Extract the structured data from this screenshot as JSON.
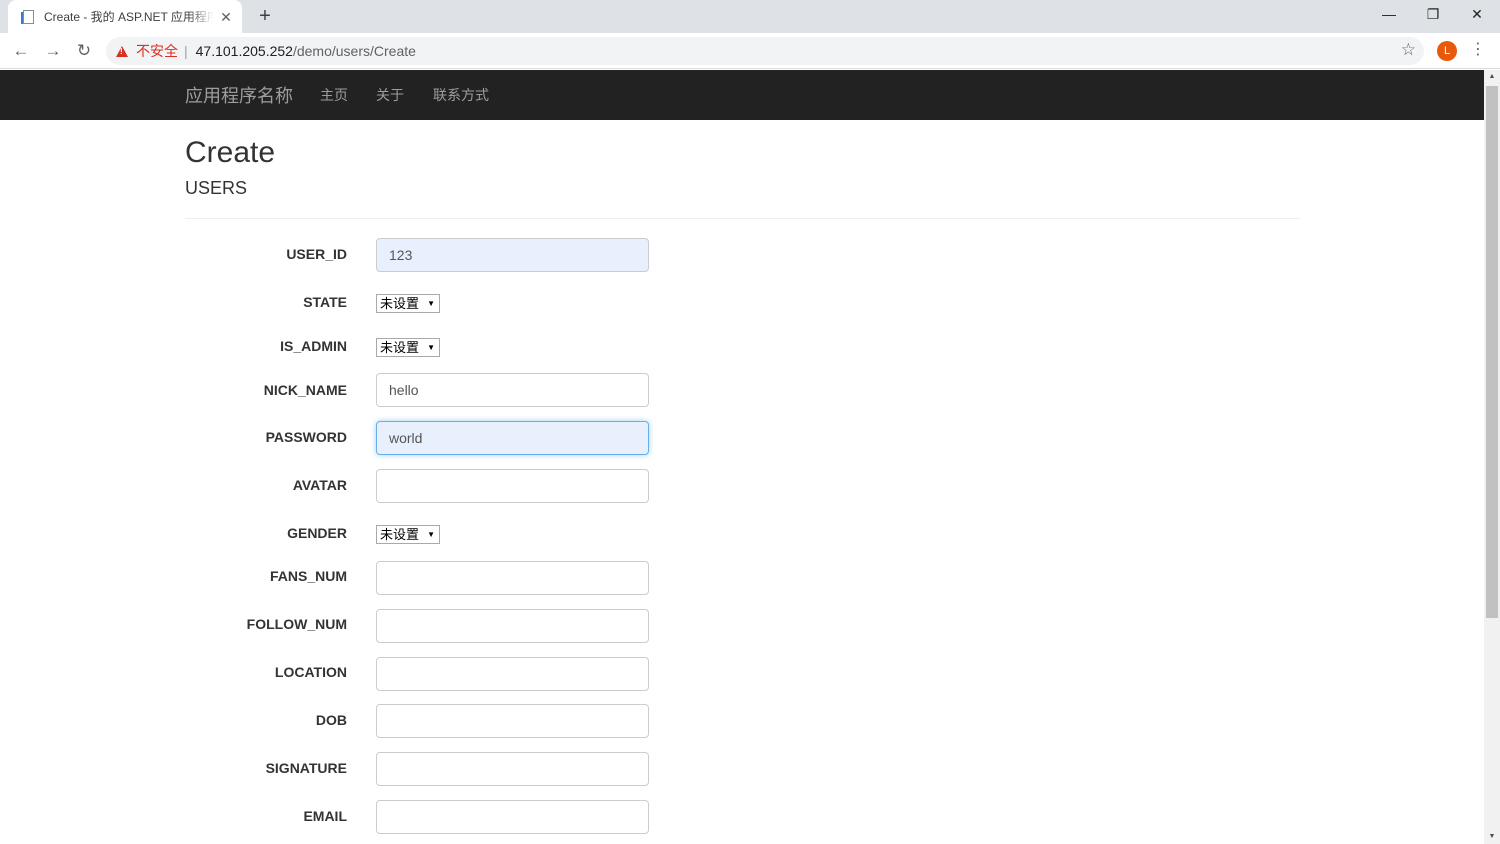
{
  "browser": {
    "tab_title": "Create - 我的 ASP.NET 应用程序",
    "tab_close": "✕",
    "new_tab": "+",
    "security_label": "不安全",
    "separator": "|",
    "url_host": "47.101.205.252",
    "url_path": "/demo/users/Create",
    "profile_initial": "L",
    "minimize": "—",
    "restore": "❐",
    "close": "✕",
    "back": "←",
    "forward": "→",
    "reload": "↻",
    "star": "☆",
    "menu": "⋮"
  },
  "navbar": {
    "brand": "应用程序名称",
    "links": [
      "主页",
      "关于",
      "联系方式"
    ]
  },
  "page": {
    "title": "Create",
    "subtitle": "USERS"
  },
  "form": {
    "user_id": {
      "label": "USER_ID",
      "value": "123"
    },
    "state": {
      "label": "STATE",
      "selected": "未设置"
    },
    "is_admin": {
      "label": "IS_ADMIN",
      "selected": "未设置"
    },
    "nick_name": {
      "label": "NICK_NAME",
      "value": "hello"
    },
    "password": {
      "label": "PASSWORD",
      "value": "world"
    },
    "avatar": {
      "label": "AVATAR",
      "value": ""
    },
    "gender": {
      "label": "GENDER",
      "selected": "未设置"
    },
    "fans_num": {
      "label": "FANS_NUM",
      "value": ""
    },
    "follow_num": {
      "label": "FOLLOW_NUM",
      "value": ""
    },
    "location": {
      "label": "LOCATION",
      "value": ""
    },
    "dob": {
      "label": "DOB",
      "value": ""
    },
    "signature": {
      "label": "SIGNATURE",
      "value": ""
    },
    "email": {
      "label": "EMAIL",
      "value": ""
    }
  },
  "colors": {
    "navbar_bg": "#222222",
    "autofill_bg": "#e8f0fe",
    "focus_border": "#66afe9",
    "insecure_red": "#d93025"
  }
}
